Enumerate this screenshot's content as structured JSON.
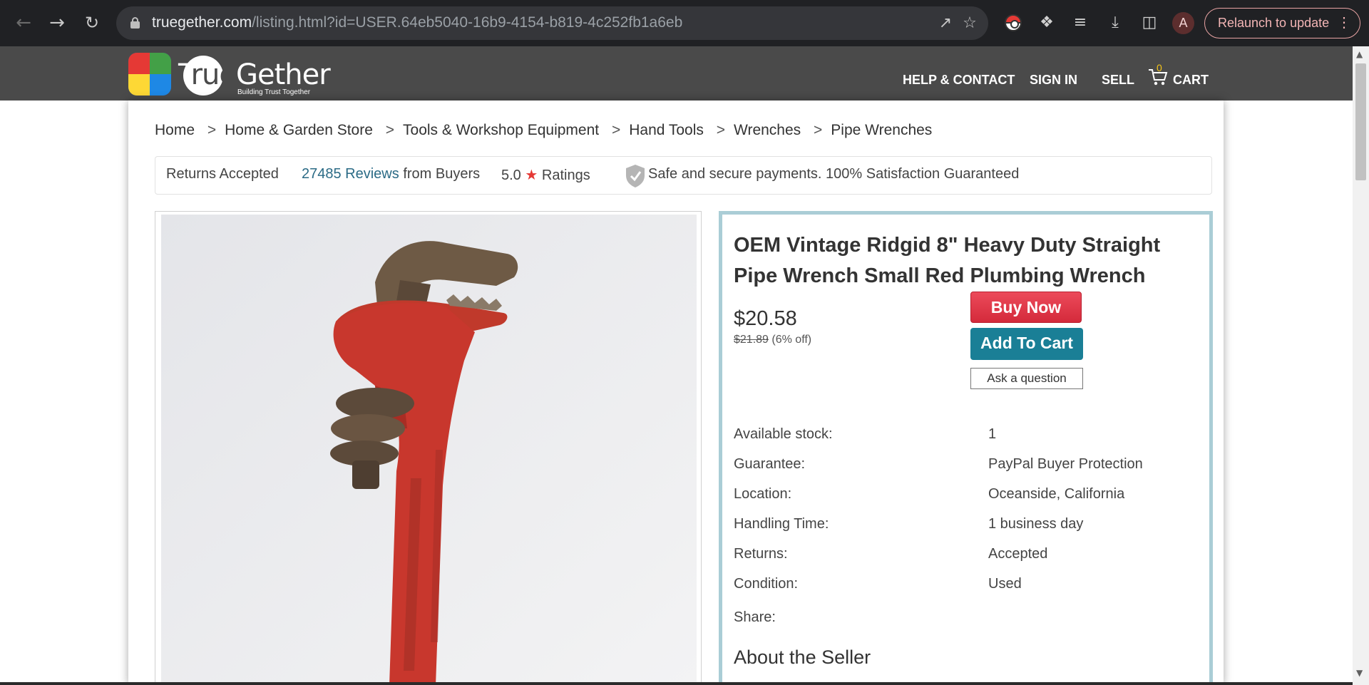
{
  "browser": {
    "url_host": "truegether.com",
    "url_path": "/listing.html?id=USER.64eb5040-16b9-4154-b819-4c252fb1a6eb",
    "profile_initial": "A",
    "relaunch_label": "Relaunch to update",
    "icons": [
      "back-icon",
      "forward-icon",
      "reload-icon",
      "lock-icon",
      "share-icon",
      "bookmark-star-icon",
      "pokeball-extension-icon",
      "extensions-puzzle-icon",
      "media-playlist-icon",
      "download-icon",
      "side-panel-icon",
      "more-vert-icon"
    ]
  },
  "site": {
    "logo_text_t": "T",
    "logo_text_rue": "rue",
    "logo_text_gether": "Gether",
    "logo_tagline": "Building Trust Together",
    "nav": {
      "help": "HELP & CONTACT",
      "signin": "SIGN IN",
      "sell": "SELL",
      "cart": "CART",
      "cart_count": "0"
    }
  },
  "breadcrumb": [
    "Home",
    "Home & Garden Store",
    "Tools & Workshop Equipment",
    "Hand Tools",
    "Wrenches",
    "Pipe Wrenches"
  ],
  "breadcrumb_sep": ">",
  "trust": {
    "returns": "Returns Accepted",
    "reviews_link": "27485 Reviews",
    "reviews_suffix": "from Buyers",
    "rating": "5.0",
    "ratings_label": "Ratings",
    "secure": "Safe and secure payments. 100% Satisfaction Guaranteed"
  },
  "product": {
    "title": "OEM Vintage Ridgid 8\" Heavy Duty Straight Pipe Wrench Small Red Plumbing Wrench",
    "price": "$20.58",
    "old_price": "$21.89",
    "discount": "(6% off)",
    "buy_now": "Buy Now",
    "add_to_cart": "Add To Cart",
    "ask_question": "Ask a question",
    "specs": [
      {
        "label": "Available stock:",
        "value": "1"
      },
      {
        "label": "Guarantee:",
        "value": "PayPal Buyer Protection"
      },
      {
        "label": "Location:",
        "value": "Oceanside, California"
      },
      {
        "label": "Handling Time:",
        "value": "1 business day"
      },
      {
        "label": "Returns:",
        "value": "Accepted"
      },
      {
        "label": "Condition:",
        "value": "Used"
      }
    ],
    "share_label": "Share:",
    "about_seller": "About the Seller"
  },
  "colors": {
    "header_bg": "#4a4a4a",
    "buy_now": "#d42a3b",
    "add_to_cart": "#1a7f96",
    "details_border": "#aacdd6",
    "link": "#2b6b86"
  }
}
